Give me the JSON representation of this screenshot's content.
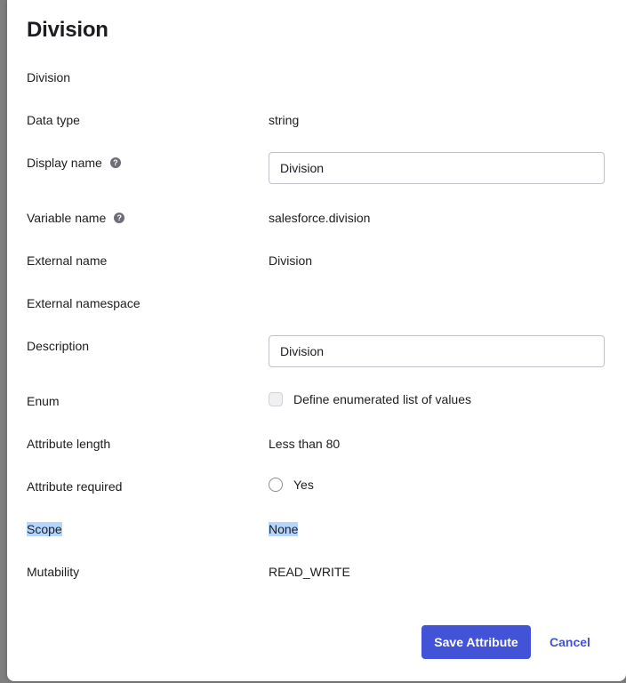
{
  "dialog": {
    "title": "Division",
    "subtitle": "Division"
  },
  "fields": {
    "data_type": {
      "label": "Data type",
      "value": "string"
    },
    "display_name": {
      "label": "Display name",
      "help_icon": "question-circle-icon",
      "value": "Division"
    },
    "variable_name": {
      "label": "Variable name",
      "help_icon": "question-circle-icon",
      "value": "salesforce.division"
    },
    "external_name": {
      "label": "External name",
      "value": "Division"
    },
    "external_namespace": {
      "label": "External namespace",
      "value": ""
    },
    "description": {
      "label": "Description",
      "value": "Division"
    },
    "enum": {
      "label": "Enum",
      "option_label": "Define enumerated list of values",
      "checked": false,
      "disabled": true
    },
    "attribute_length": {
      "label": "Attribute length",
      "value": "Less than 80"
    },
    "attribute_required": {
      "label": "Attribute required",
      "option_label": "Yes",
      "checked": false
    },
    "scope": {
      "label": "Scope",
      "value": "None"
    },
    "mutability": {
      "label": "Mutability",
      "value": "READ_WRITE"
    }
  },
  "actions": {
    "save_label": "Save Attribute",
    "cancel_label": "Cancel"
  },
  "colors": {
    "primary": "#4353d8",
    "text": "#1d1d21",
    "selection_highlight": "#b4d5fe"
  }
}
